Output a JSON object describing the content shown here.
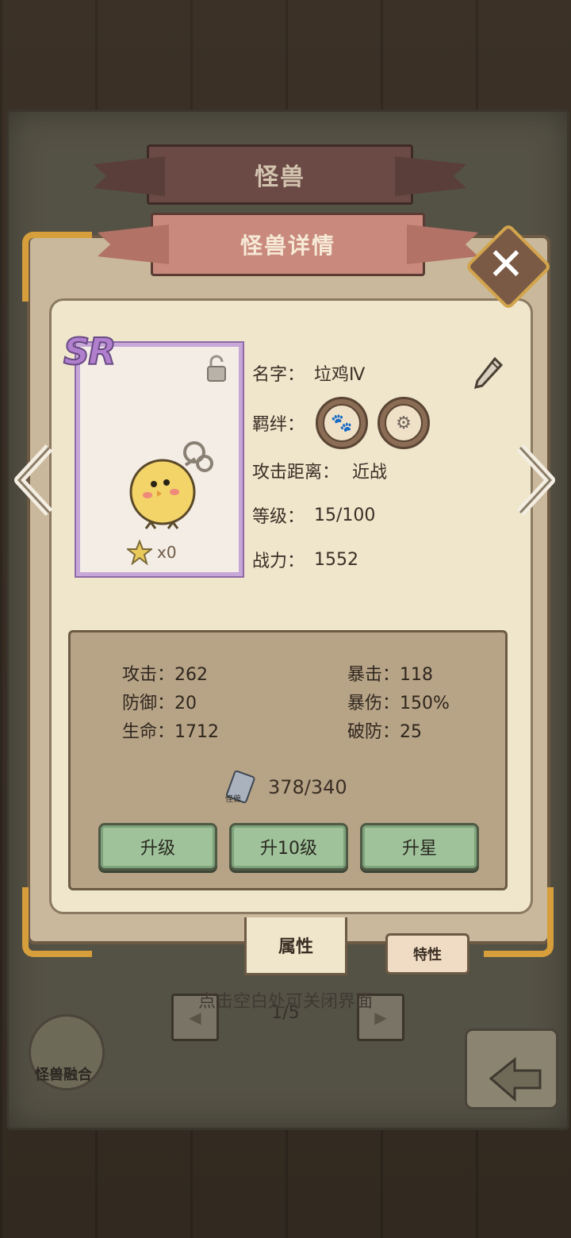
{
  "header": {
    "back_title": "怪兽",
    "front_title": "怪兽详情"
  },
  "card": {
    "rarity": "SR",
    "star_count": "x0"
  },
  "info": {
    "name_label": "名字：",
    "name_value": "垃鸡Ⅳ",
    "bond_label": "羁绊：",
    "range_label": "攻击距离：",
    "range_value": "近战",
    "level_label": "等级：",
    "level_value": "15/100",
    "power_label": "战力：",
    "power_value": "1552"
  },
  "stats": {
    "attack": "攻击：262",
    "defense": "防御：20",
    "hp": "生命：1712",
    "crit": "暴击：118",
    "crit_dmg": "暴伤：150%",
    "armor_break": "破防：25"
  },
  "exp": {
    "icon_label": "怪兽",
    "value": "378/340"
  },
  "buttons": {
    "level_up": "升级",
    "level_up_10": "升10级",
    "star_up": "升星"
  },
  "tabs": {
    "attributes": "属性",
    "traits": "特性"
  },
  "footer": {
    "close_hint": "点击空白处可关闭界面",
    "page": "1/5",
    "fusion_label": "怪兽融合"
  },
  "icons": [
    "close-icon",
    "left-arrow-icon",
    "right-arrow-icon",
    "lock-icon",
    "pencil-icon",
    "paw-icon",
    "gear-icon",
    "star-icon",
    "exp-card-icon",
    "back-arrow-icon"
  ]
}
